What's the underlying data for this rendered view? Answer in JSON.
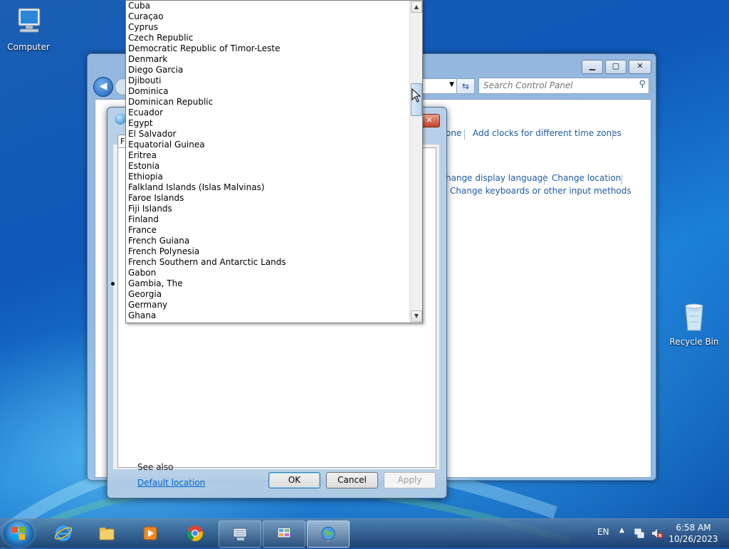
{
  "desktop": {
    "icons": [
      {
        "label": "Computer",
        "icon": "computer-icon"
      },
      {
        "label": "Recycle Bin",
        "icon": "recycle-bin-icon"
      }
    ]
  },
  "control_panel": {
    "search_placeholder": "Search Control Panel",
    "links": {
      "time_zone_tail": "one",
      "add_clocks": "Add clocks for different time zones",
      "change_display_language": "hange display language",
      "change_location": "Change location",
      "change_keyboards": "Change keyboards or other input methods"
    }
  },
  "region_dialog": {
    "close_label": "✕",
    "tab_stub": "F",
    "see_also": "See also",
    "default_location": "Default location",
    "buttons": {
      "ok": "OK",
      "cancel": "Cancel",
      "apply": "Apply"
    }
  },
  "location_dropdown": {
    "items": [
      "Cuba",
      "Curaçao",
      "Cyprus",
      "Czech Republic",
      "Democratic Republic of Timor-Leste",
      "Denmark",
      "Diego Garcia",
      "Djibouti",
      "Dominica",
      "Dominican Republic",
      "Ecuador",
      "Egypt",
      "El Salvador",
      "Equatorial Guinea",
      "Eritrea",
      "Estonia",
      "Ethiopia",
      "Falkland Islands (Islas Malvinas)",
      "Faroe Islands",
      "Fiji Islands",
      "Finland",
      "France",
      "French Guiana",
      "French Polynesia",
      "French Southern and Antarctic Lands",
      "Gabon",
      "Gambia, The",
      "Georgia",
      "Germany",
      "Ghana"
    ]
  },
  "taskbar": {
    "apps": [
      {
        "name": "internet-explorer",
        "state": "pinned"
      },
      {
        "name": "file-explorer",
        "state": "pinned"
      },
      {
        "name": "media-player",
        "state": "pinned"
      },
      {
        "name": "chrome",
        "state": "pinned"
      },
      {
        "name": "on-screen-keyboard",
        "state": "open"
      },
      {
        "name": "control-panel",
        "state": "open"
      },
      {
        "name": "region",
        "state": "active"
      }
    ],
    "language": "EN",
    "time": "6:58 AM",
    "date": "10/26/2023"
  }
}
